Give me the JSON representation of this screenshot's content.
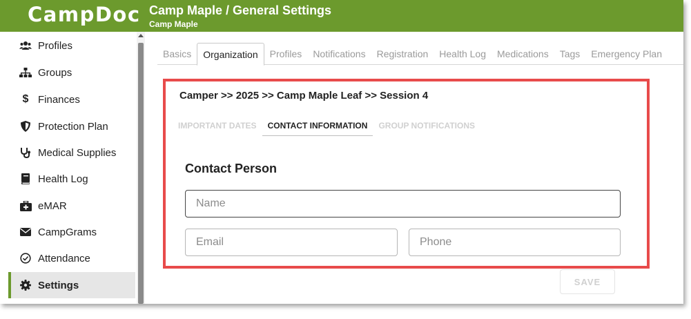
{
  "app": {
    "logo": "CampDoc",
    "title": "Camp Maple / General Settings",
    "subtitle": "Camp Maple"
  },
  "colors": {
    "brand": "#6c9a2d",
    "highlight": "#e84b4b"
  },
  "sidebar": {
    "items": [
      {
        "label": "Profiles",
        "icon": "users-icon"
      },
      {
        "label": "Groups",
        "icon": "sitemap-icon"
      },
      {
        "label": "Finances",
        "icon": "dollar-icon"
      },
      {
        "label": "Protection Plan",
        "icon": "shield-icon"
      },
      {
        "label": "Medical Supplies",
        "icon": "stethoscope-icon"
      },
      {
        "label": "Health Log",
        "icon": "book-icon"
      },
      {
        "label": "eMAR",
        "icon": "medkit-icon"
      },
      {
        "label": "CampGrams",
        "icon": "envelope-icon"
      },
      {
        "label": "Attendance",
        "icon": "check-circle-icon"
      },
      {
        "label": "Settings",
        "icon": "gear-icon",
        "active": true
      }
    ]
  },
  "tabs": [
    {
      "label": "Basics"
    },
    {
      "label": "Organization",
      "active": true
    },
    {
      "label": "Profiles"
    },
    {
      "label": "Notifications"
    },
    {
      "label": "Registration"
    },
    {
      "label": "Health Log"
    },
    {
      "label": "Medications"
    },
    {
      "label": "Tags"
    },
    {
      "label": "Emergency Plan"
    }
  ],
  "breadcrumb": "Camper >> 2025 >> Camp Maple Leaf >> Session 4",
  "subtabs": [
    {
      "label": "IMPORTANT DATES"
    },
    {
      "label": "CONTACT INFORMATION",
      "active": true
    },
    {
      "label": "GROUP NOTIFICATIONS"
    }
  ],
  "form": {
    "section_title": "Contact Person",
    "name": {
      "value": "",
      "placeholder": "Name"
    },
    "email": {
      "value": "",
      "placeholder": "Email"
    },
    "phone": {
      "value": "",
      "placeholder": "Phone"
    },
    "save_label": "SAVE"
  }
}
